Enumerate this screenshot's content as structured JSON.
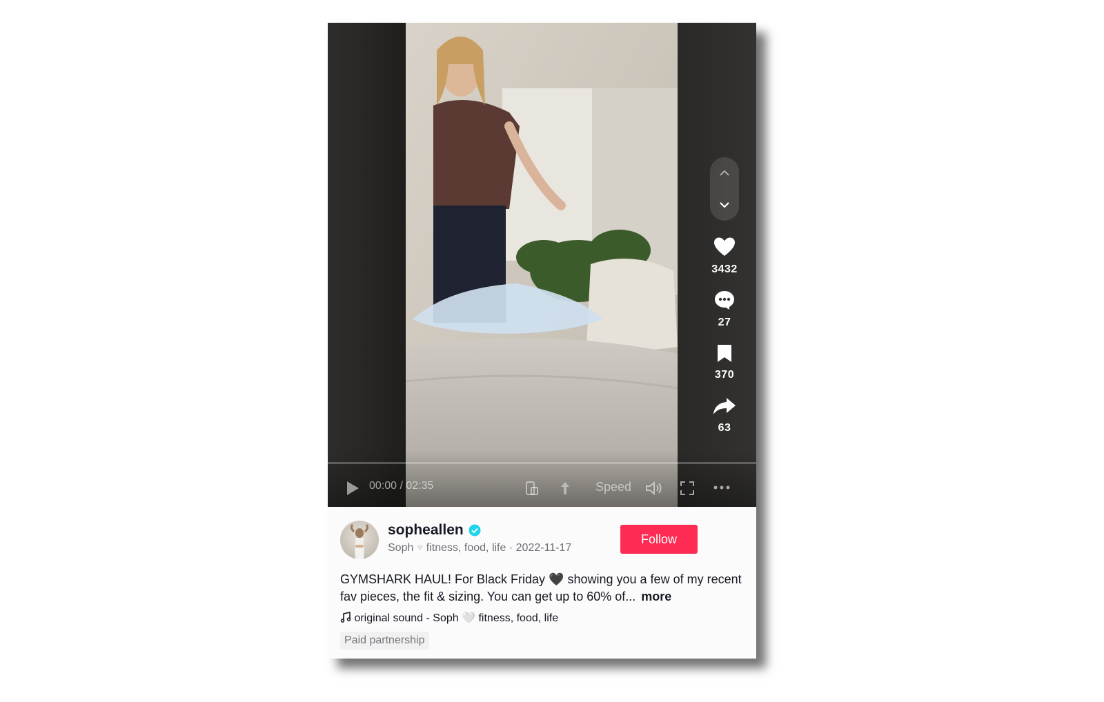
{
  "video": {
    "time": "00:00 / 02:35",
    "speed_label": "Speed",
    "actions": {
      "likes": "3432",
      "comments": "27",
      "saves": "370",
      "shares": "63"
    }
  },
  "author": {
    "username": "sopheallen",
    "display_name": "Soph",
    "bio_tagline": "fitness, food, life",
    "date": "2022-11-17"
  },
  "follow_label": "Follow",
  "description": {
    "text": "GYMSHARK HAUL! For Black Friday 🖤 showing you a few of my recent fav pieces, the fit & sizing. You can get up to 60% of...",
    "more_label": "more"
  },
  "music": {
    "text": "original sound - Soph 🤍 fitness, food, life"
  },
  "paid_label": "Paid partnership",
  "colors": {
    "follow_bg": "#fe2c55",
    "verified": "#20d5ec"
  }
}
